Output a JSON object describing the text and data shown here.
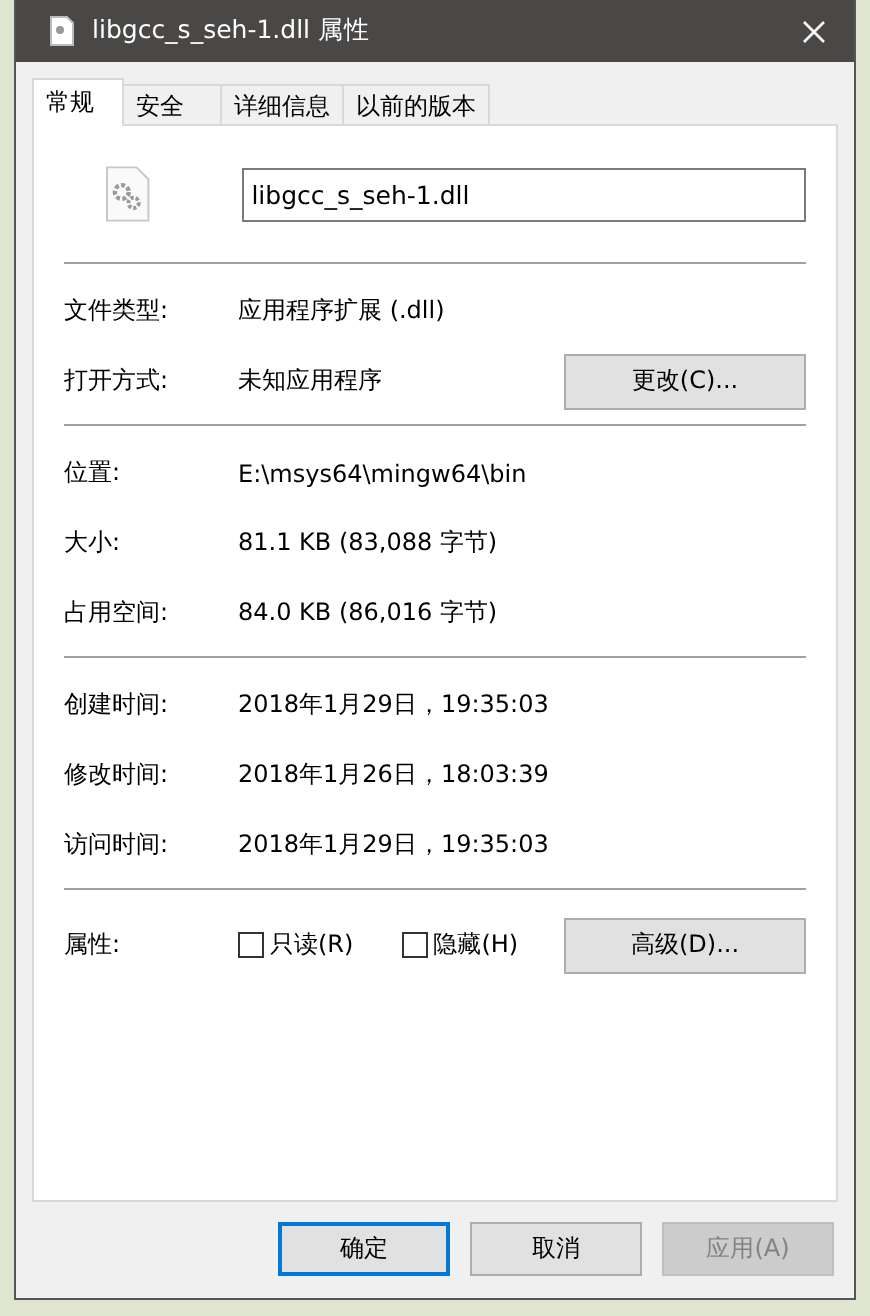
{
  "window": {
    "title": "libgcc_s_seh-1.dll 属性"
  },
  "tabs": [
    {
      "label": "常规",
      "selected": true
    },
    {
      "label": "安全",
      "selected": false
    },
    {
      "label": "详细信息",
      "selected": false
    },
    {
      "label": "以前的版本",
      "selected": false
    }
  ],
  "file_name": "libgcc_s_seh-1.dll",
  "sections": [
    [
      {
        "label": "文件类型:",
        "value": "应用程序扩展 (.dll)"
      },
      {
        "label": "打开方式:",
        "value": "未知应用程序",
        "button": "更改(C)..."
      }
    ],
    [
      {
        "label": "位置:",
        "value": "E:\\msys64\\mingw64\\bin"
      },
      {
        "label": "大小:",
        "value": "81.1 KB (83,088 字节)"
      },
      {
        "label": "占用空间:",
        "value": "84.0 KB (86,016 字节)"
      }
    ],
    [
      {
        "label": "创建时间:",
        "value": "2018年1月29日，19:35:03"
      },
      {
        "label": "修改时间:",
        "value": "2018年1月26日，18:03:39"
      },
      {
        "label": "访问时间:",
        "value": "2018年1月29日，19:35:03"
      }
    ]
  ],
  "attributes": {
    "label": "属性:",
    "checkboxes": [
      {
        "label": "只读(R)",
        "checked": false
      },
      {
        "label": "隐藏(H)",
        "checked": false
      }
    ],
    "button": "高级(D)..."
  },
  "buttons": [
    {
      "label": "确定",
      "kind": "default"
    },
    {
      "label": "取消",
      "kind": "normal"
    },
    {
      "label": "应用(A)",
      "kind": "disabled"
    }
  ]
}
